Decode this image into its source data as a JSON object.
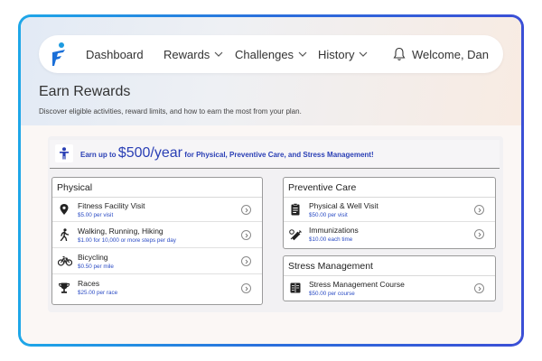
{
  "nav": {
    "items": [
      {
        "label": "Dashboard"
      },
      {
        "label": "Rewards"
      },
      {
        "label": "Challenges"
      },
      {
        "label": "History"
      }
    ],
    "welcome": "Welcome, Dan"
  },
  "header": {
    "title": "Earn Rewards",
    "subtitle": "Discover eligible activities, reward limits, and how to earn the most from your plan."
  },
  "banner": {
    "prefix": "Earn up to",
    "amount": "$500/year",
    "suffix": "for Physical, Preventive Care, and Stress Management!"
  },
  "groups": {
    "physical": {
      "title": "Physical",
      "items": [
        {
          "name": "Fitness Facility Visit",
          "detail": "$5.00 per visit",
          "icon": "location-pin-icon"
        },
        {
          "name": "Walking, Running, Hiking",
          "detail": "$1.00 for 10,000 or more steps per day",
          "icon": "walking-person-icon"
        },
        {
          "name": "Bicycling",
          "detail": "$0.50 per mile",
          "icon": "bicycle-icon"
        },
        {
          "name": "Races",
          "detail": "$25.00 per race",
          "icon": "trophy-icon"
        }
      ]
    },
    "preventive": {
      "title": "Preventive Care",
      "items": [
        {
          "name": "Physical & Well Visit",
          "detail": "$50.00 per visit",
          "icon": "clipboard-icon"
        },
        {
          "name": "Immunizations",
          "detail": "$10.00 each time",
          "icon": "syringe-icon"
        }
      ]
    },
    "stress": {
      "title": "Stress Management",
      "items": [
        {
          "name": "Stress Management Course",
          "detail": "$50.00 per course",
          "icon": "course-book-icon"
        }
      ]
    }
  },
  "colors": {
    "accent": "#2a3fb5",
    "frame_start": "#1ea7e8",
    "frame_end": "#3b4fd6"
  }
}
